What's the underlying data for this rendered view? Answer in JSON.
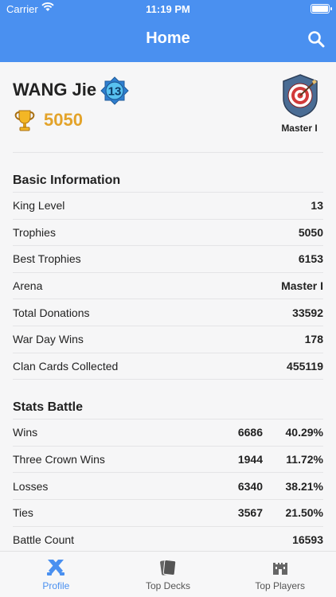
{
  "statusbar": {
    "carrier": "Carrier",
    "time": "11:19 PM"
  },
  "header": {
    "title": "Home"
  },
  "profile": {
    "name": "WANG Jie",
    "king_level": "13",
    "trophies": "5050",
    "arena": "Master I"
  },
  "basic": {
    "title": "Basic Information",
    "rows": [
      {
        "label": "King Level",
        "value": "13"
      },
      {
        "label": "Trophies",
        "value": "5050"
      },
      {
        "label": "Best Trophies",
        "value": "6153"
      },
      {
        "label": "Arena",
        "value": "Master I"
      },
      {
        "label": "Total Donations",
        "value": "33592"
      },
      {
        "label": "War Day Wins",
        "value": "178"
      },
      {
        "label": "Clan Cards Collected",
        "value": "455119"
      }
    ]
  },
  "stats": {
    "title": "Stats Battle",
    "rows": [
      {
        "label": "Wins",
        "value": "6686",
        "pct": "40.29%"
      },
      {
        "label": "Three Crown Wins",
        "value": "1944",
        "pct": "11.72%"
      },
      {
        "label": "Losses",
        "value": "6340",
        "pct": "38.21%"
      },
      {
        "label": "Ties",
        "value": "3567",
        "pct": "21.50%"
      },
      {
        "label": "Battle Count",
        "value": "16593",
        "pct": ""
      }
    ]
  },
  "tabs": [
    {
      "label": "Profile",
      "icon": "crossed-swords-icon",
      "active": true
    },
    {
      "label": "Top Decks",
      "icon": "cards-icon",
      "active": false
    },
    {
      "label": "Top Players",
      "icon": "castle-icon",
      "active": false
    }
  ],
  "colors": {
    "primary": "#4a90f0",
    "trophy": "#e3a32a",
    "background": "#f6f6f7"
  }
}
